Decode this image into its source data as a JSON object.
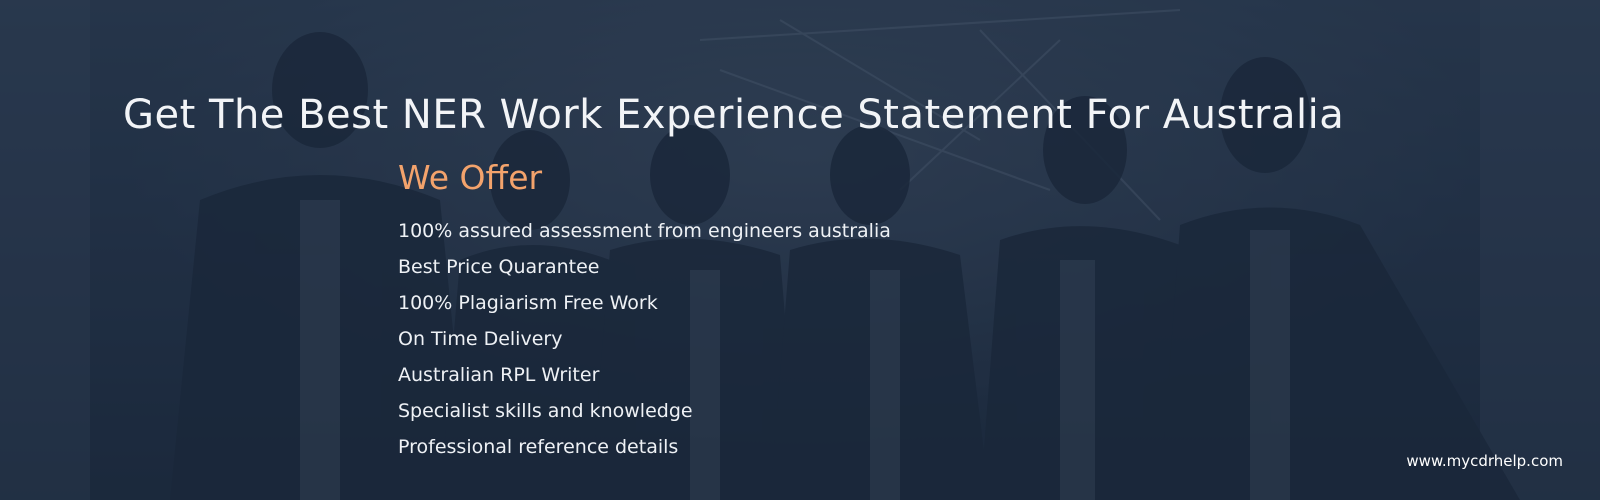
{
  "banner": {
    "headline": "Get The Best NER Work Experience Statement For Australia",
    "subhead": "We Offer",
    "offers": [
      "100% assured assessment from engineers australia",
      "Best Price Quarantee",
      "100% Plagiarism Free Work",
      "On Time Delivery",
      "Australian RPL Writer",
      "Specialist skills and knowledge",
      "Professional reference details"
    ],
    "website": "www.mycdrhelp.com"
  },
  "colors": {
    "overlay": "#1f2d40",
    "headline": "#f2f4f7",
    "accent": "#f3a36c",
    "text": "#eef1f5"
  }
}
